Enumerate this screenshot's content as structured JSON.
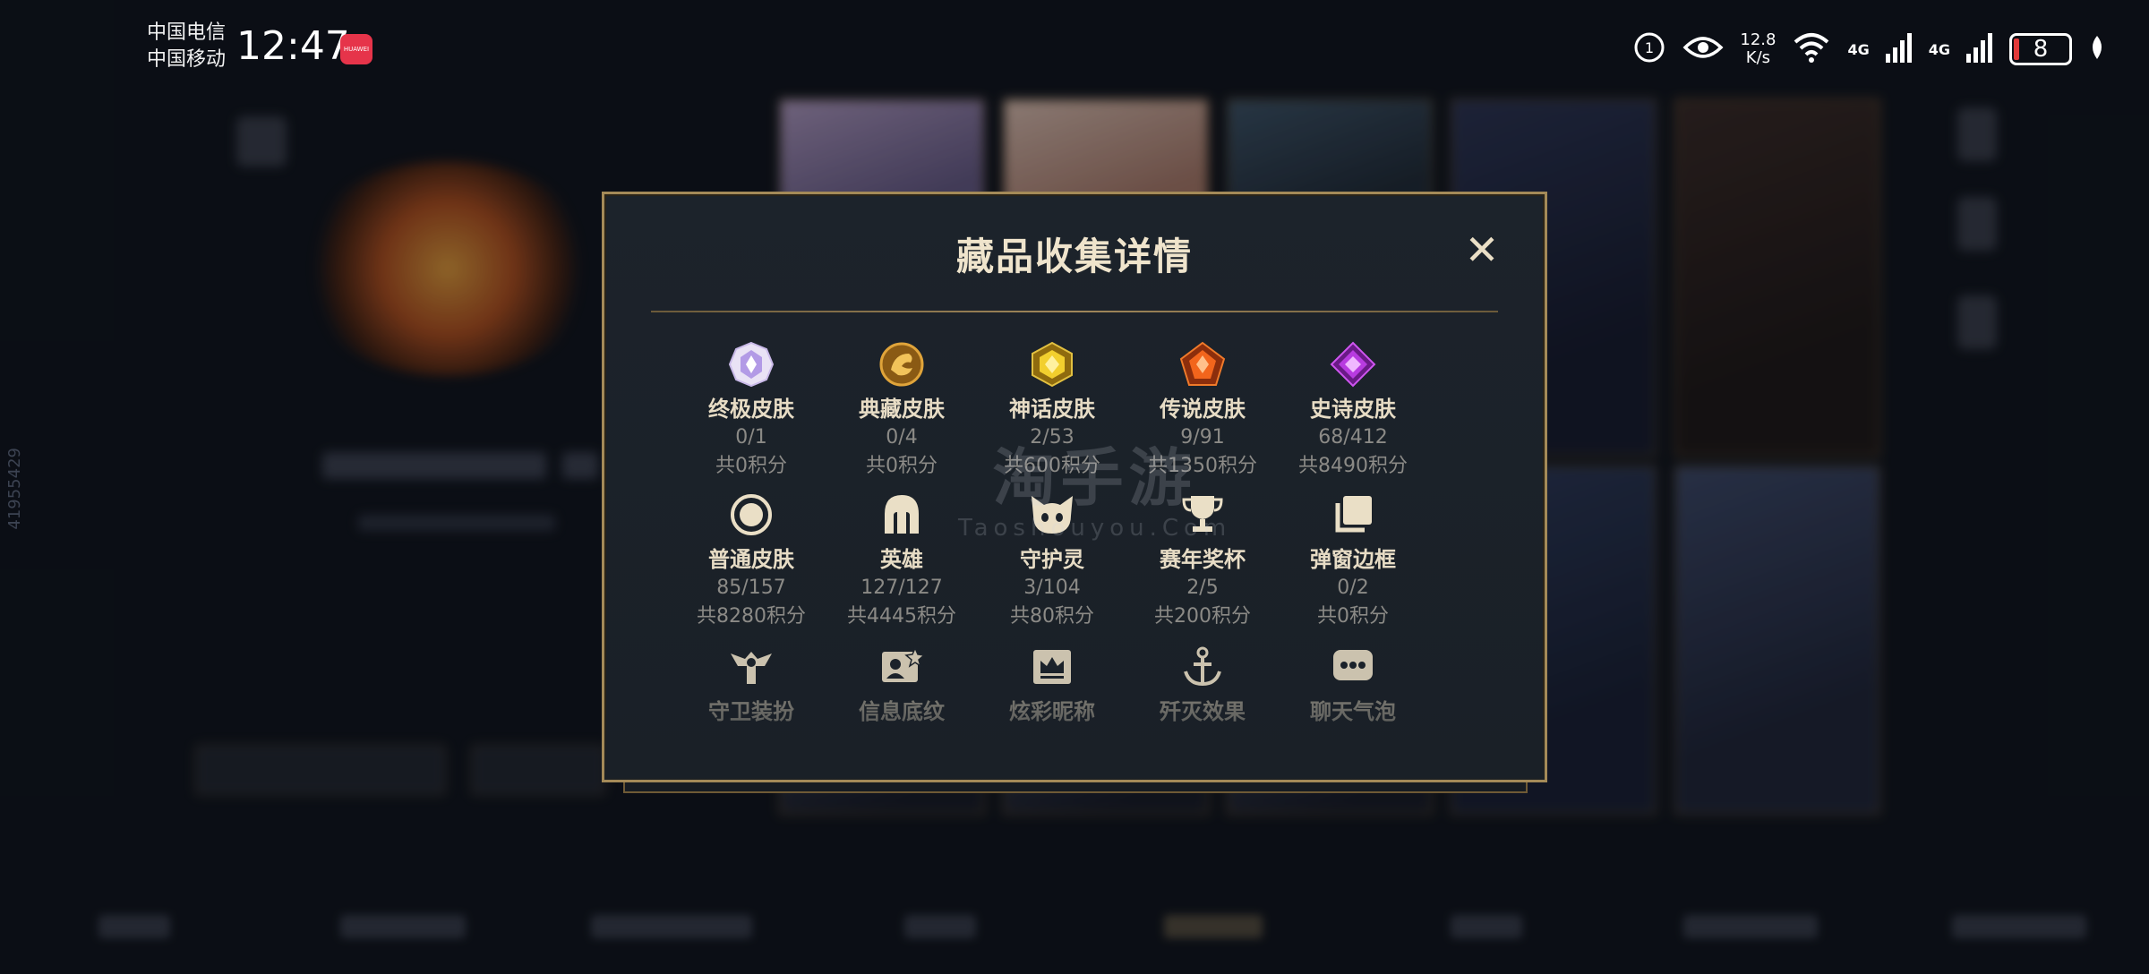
{
  "status_bar": {
    "carrier_1": "中国电信",
    "carrier_2": "中国移动",
    "time": "12:47",
    "app_badge": "HUAWEI",
    "net_speed_value": "12.8",
    "net_speed_unit": "K/s",
    "network_1": "4G",
    "network_2": "4G",
    "battery_level": "8"
  },
  "side_id": "41955429",
  "watermark": {
    "line1": "淘手游",
    "line2": "Taoshouyou.Com"
  },
  "modal": {
    "title": "藏品收集详情",
    "close_label": "✕",
    "items": [
      {
        "name": "终极皮肤",
        "count": "0/1",
        "points": "共0积分",
        "icon": "ultimate-skin-icon",
        "color": "#b6a4e8"
      },
      {
        "name": "典藏皮肤",
        "count": "0/4",
        "points": "共0积分",
        "icon": "legendary-collection-icon",
        "color": "#d9962a"
      },
      {
        "name": "神话皮肤",
        "count": "2/53",
        "points": "共600积分",
        "icon": "myth-skin-icon",
        "color": "#e6c12b"
      },
      {
        "name": "传说皮肤",
        "count": "9/91",
        "points": "共1350积分",
        "icon": "legend-skin-icon",
        "color": "#e8621f"
      },
      {
        "name": "史诗皮肤",
        "count": "68/412",
        "points": "共8490积分",
        "icon": "epic-skin-icon",
        "color": "#b93be0"
      },
      {
        "name": "普通皮肤",
        "count": "85/157",
        "points": "共8280积分",
        "icon": "normal-skin-icon",
        "color": "#eadfc6"
      },
      {
        "name": "英雄",
        "count": "127/127",
        "points": "共4445积分",
        "icon": "hero-helmet-icon",
        "color": "#eadfc6"
      },
      {
        "name": "守护灵",
        "count": "3/104",
        "points": "共80积分",
        "icon": "guardian-spirit-icon",
        "color": "#eadfc6"
      },
      {
        "name": "赛年奖杯",
        "count": "2/5",
        "points": "共200积分",
        "icon": "trophy-icon",
        "color": "#eadfc6"
      },
      {
        "name": "弹窗边框",
        "count": "0/2",
        "points": "共0积分",
        "icon": "frame-icon",
        "color": "#eadfc6"
      },
      {
        "name": "守卫装扮",
        "icon": "guard-outfit-icon",
        "color": "#eadfc6"
      },
      {
        "name": "信息底纹",
        "icon": "profile-card-icon",
        "color": "#eadfc6"
      },
      {
        "name": "炫彩昵称",
        "icon": "nickname-crown-icon",
        "color": "#eadfc6"
      },
      {
        "name": "歼灭效果",
        "icon": "elimination-effect-icon",
        "color": "#eadfc6"
      },
      {
        "name": "聊天气泡",
        "icon": "chat-bubble-icon",
        "color": "#eadfc6"
      }
    ]
  }
}
